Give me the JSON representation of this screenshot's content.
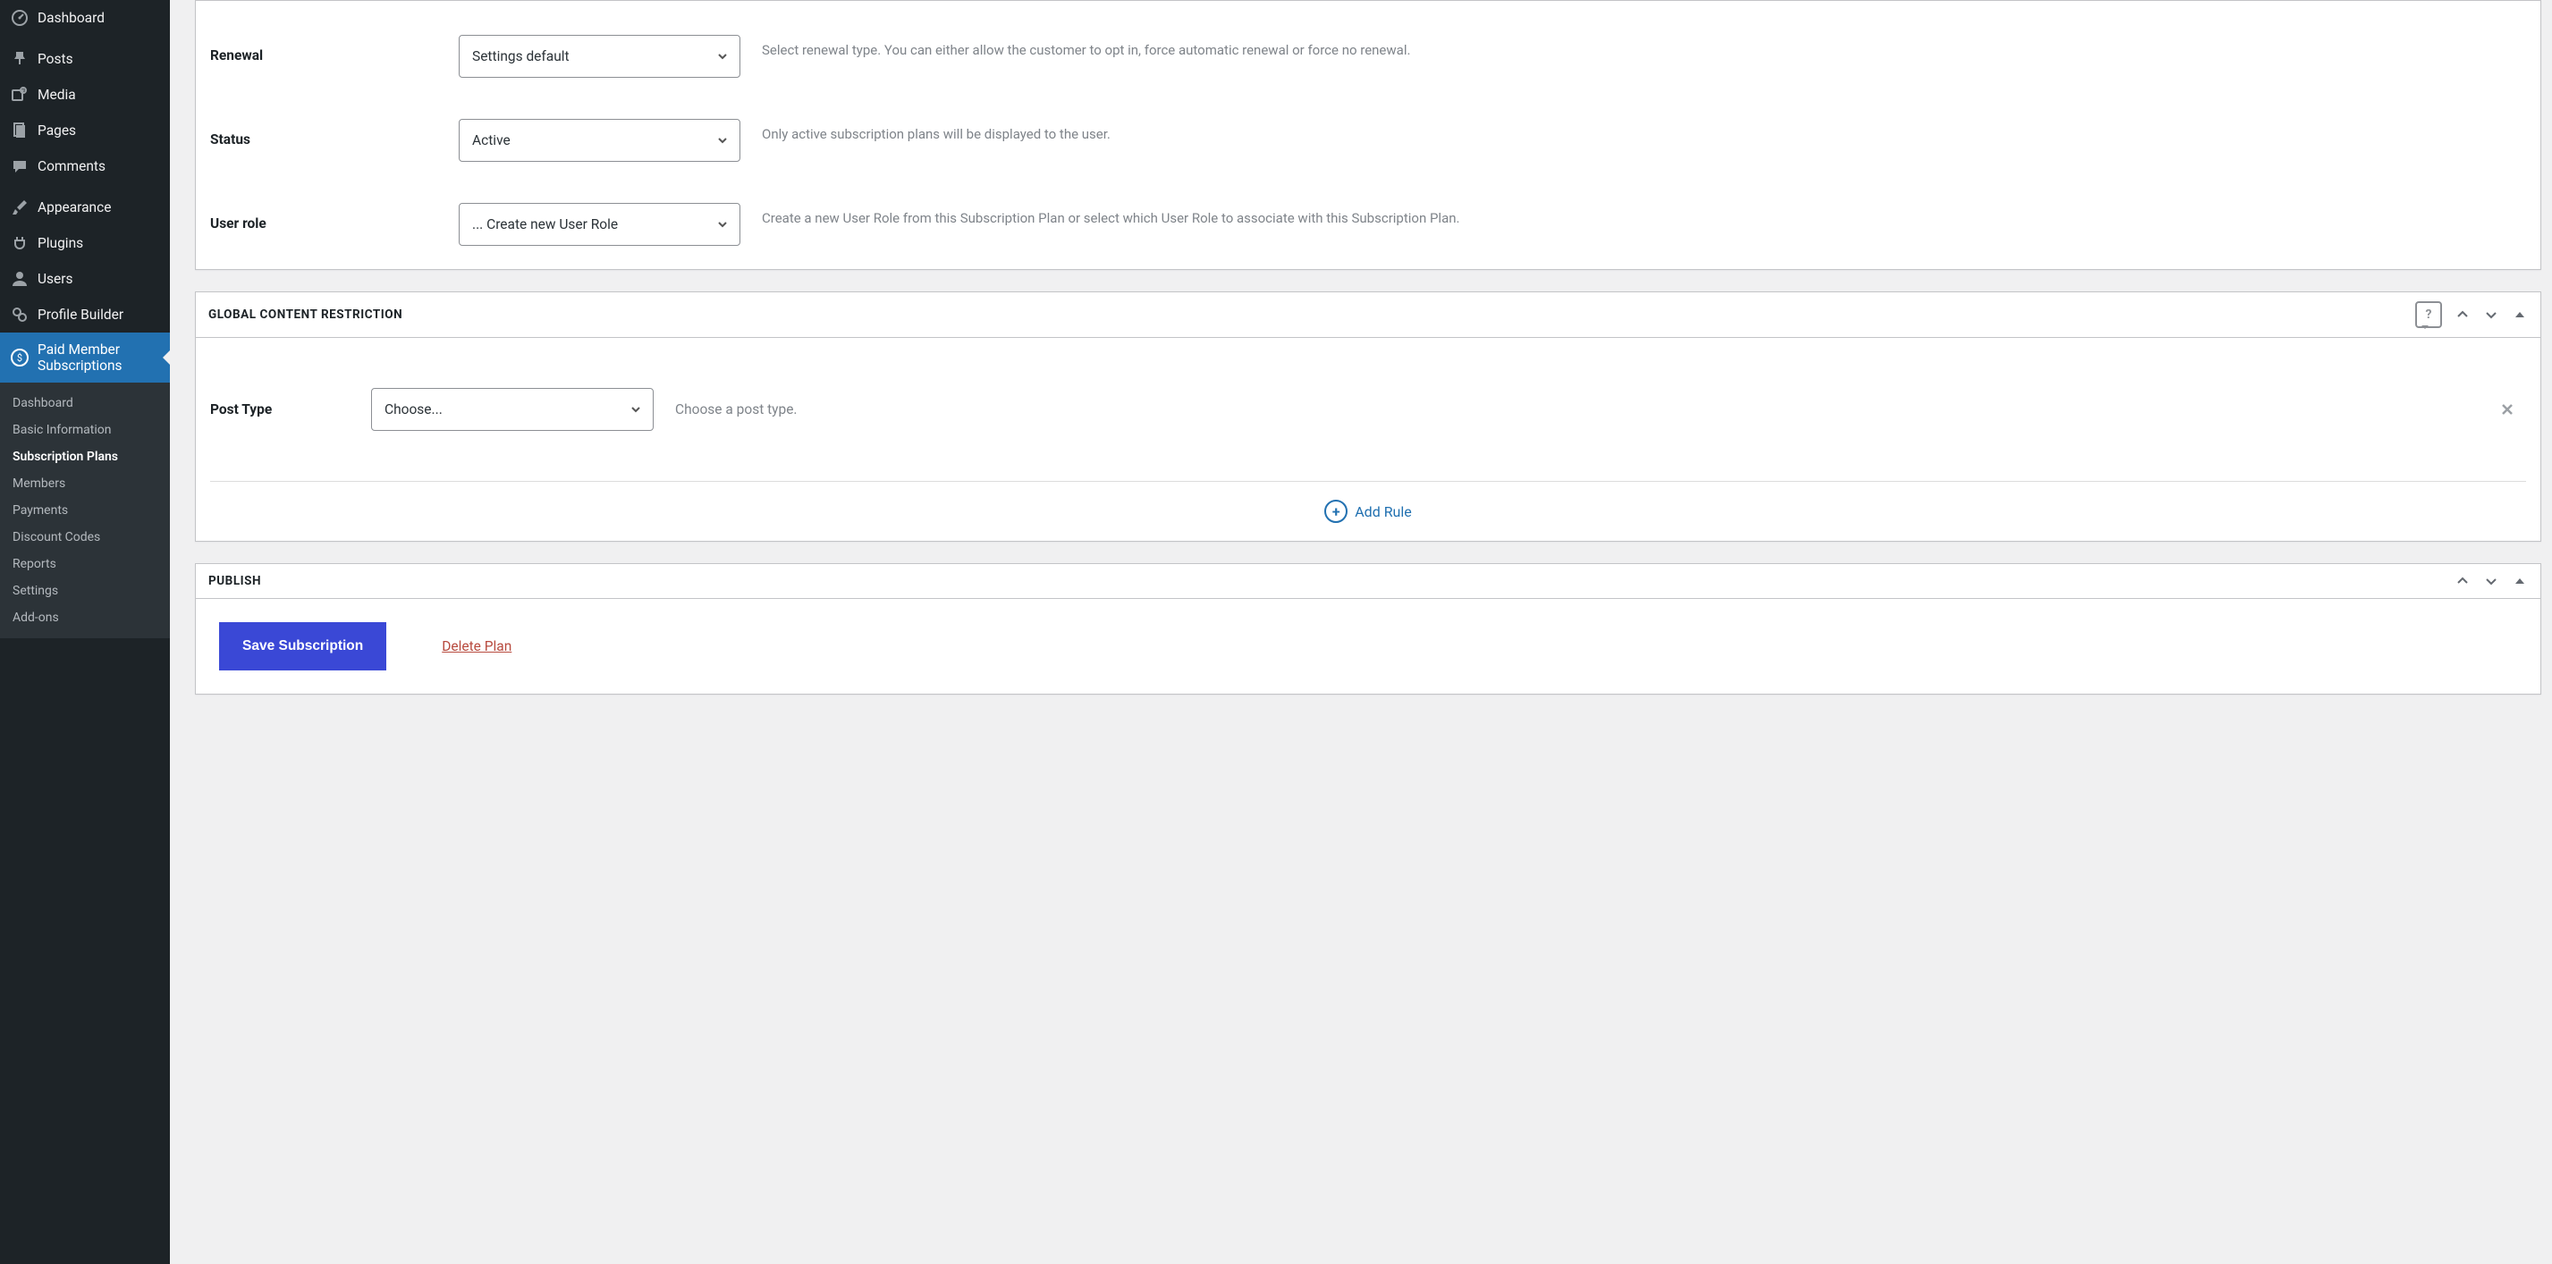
{
  "sidebar": {
    "items": [
      {
        "label": "Dashboard",
        "icon": "gauge"
      },
      {
        "label": "Posts",
        "icon": "pin"
      },
      {
        "label": "Media",
        "icon": "media"
      },
      {
        "label": "Pages",
        "icon": "pages"
      },
      {
        "label": "Comments",
        "icon": "comment"
      },
      {
        "label": "Appearance",
        "icon": "brush"
      },
      {
        "label": "Plugins",
        "icon": "plug"
      },
      {
        "label": "Users",
        "icon": "user"
      },
      {
        "label": "Profile Builder",
        "icon": "pb"
      },
      {
        "label": "Paid Member Subscriptions",
        "icon": "pms"
      }
    ],
    "sub": [
      "Dashboard",
      "Basic Information",
      "Subscription Plans",
      "Members",
      "Payments",
      "Discount Codes",
      "Reports",
      "Settings",
      "Add-ons"
    ],
    "sub_current": "Subscription Plans"
  },
  "settings_box": {
    "fields": {
      "renewal": {
        "label": "Renewal",
        "value": "Settings default",
        "desc": "Select renewal type. You can either allow the customer to opt in, force automatic renewal or force no renewal."
      },
      "status": {
        "label": "Status",
        "value": "Active",
        "desc": "Only active subscription plans will be displayed to the user."
      },
      "user_role": {
        "label": "User role",
        "value": "... Create new User Role",
        "desc": "Create a new User Role from this Subscription Plan or select which User Role to associate with this Subscription Plan."
      }
    }
  },
  "restriction_box": {
    "title": "Global Content Restriction",
    "post_type": {
      "label": "Post Type",
      "value": "Choose...",
      "desc": "Choose a post type."
    },
    "add_rule_label": "Add Rule"
  },
  "publish_box": {
    "title": "Publish",
    "save_label": "Save Subscription",
    "delete_label": "Delete Plan"
  }
}
